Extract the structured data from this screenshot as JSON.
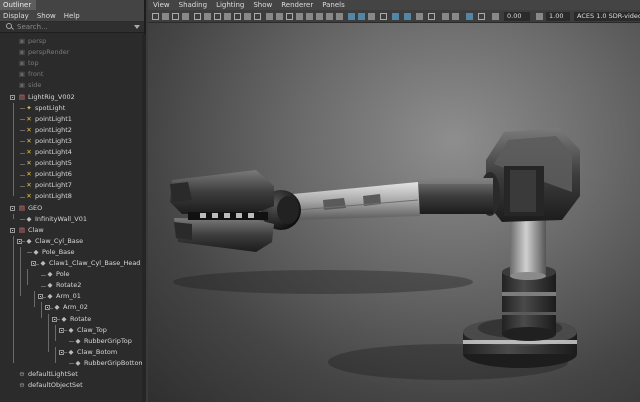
{
  "outliner": {
    "tab_label": "Outliner",
    "menus": [
      "Display",
      "Show",
      "Help"
    ],
    "search_placeholder": "Search...",
    "items": [
      {
        "label": "persp",
        "icon": "camera-icon",
        "dim": true
      },
      {
        "label": "perspRender",
        "icon": "camera-icon",
        "dim": true
      },
      {
        "label": "top",
        "icon": "camera-icon",
        "dim": true
      },
      {
        "label": "front",
        "icon": "camera-icon",
        "dim": true
      },
      {
        "label": "side",
        "icon": "camera-icon",
        "dim": true
      },
      {
        "label": "LightRig_V002",
        "icon": "group-icon"
      },
      {
        "label": "spotLight",
        "icon": "spotlight-icon"
      },
      {
        "label": "pointLight1",
        "icon": "pointlight-icon"
      },
      {
        "label": "pointLight2",
        "icon": "pointlight-icon"
      },
      {
        "label": "pointLight3",
        "icon": "pointlight-icon"
      },
      {
        "label": "pointLight4",
        "icon": "pointlight-icon"
      },
      {
        "label": "pointLight5",
        "icon": "pointlight-icon"
      },
      {
        "label": "pointLight6",
        "icon": "pointlight-icon"
      },
      {
        "label": "pointLight7",
        "icon": "pointlight-icon"
      },
      {
        "label": "pointLight8",
        "icon": "pointlight-icon"
      },
      {
        "label": "GEO",
        "icon": "group-icon"
      },
      {
        "label": "InfinityWall_V01",
        "icon": "mesh-icon"
      },
      {
        "label": "Claw",
        "icon": "group-icon"
      },
      {
        "label": "Claw_Cyl_Base",
        "icon": "mesh-icon"
      },
      {
        "label": "Pole_Base",
        "icon": "mesh-icon"
      },
      {
        "label": "Claw1_Claw_Cyl_Base_Head",
        "icon": "mesh-icon"
      },
      {
        "label": "Pole",
        "icon": "mesh-icon"
      },
      {
        "label": "Rotate2",
        "icon": "mesh-icon"
      },
      {
        "label": "Arm_01",
        "icon": "mesh-icon"
      },
      {
        "label": "Arm_02",
        "icon": "mesh-icon"
      },
      {
        "label": "Rotate",
        "icon": "mesh-icon"
      },
      {
        "label": "Claw_Top",
        "icon": "mesh-icon"
      },
      {
        "label": "RubberGripTop",
        "icon": "mesh-icon"
      },
      {
        "label": "Claw_Botom",
        "icon": "mesh-icon"
      },
      {
        "label": "RubberGripBottom",
        "icon": "mesh-icon"
      },
      {
        "label": "defaultLightSet",
        "icon": "set-icon"
      },
      {
        "label": "defaultObjectSet",
        "icon": "set-icon"
      }
    ]
  },
  "viewport": {
    "menus": [
      "View",
      "Shading",
      "Lighting",
      "Show",
      "Renderer",
      "Panels"
    ],
    "exposure_value": "0.00",
    "gamma_value": "1.00",
    "color_space": "ACES 1.0 SDR-video (sRGB)"
  },
  "colors": {
    "accent": "#5285a6",
    "panel_bg": "#2b2b2b",
    "menubar_bg": "#444444",
    "light_icon": "#e0c23c"
  }
}
